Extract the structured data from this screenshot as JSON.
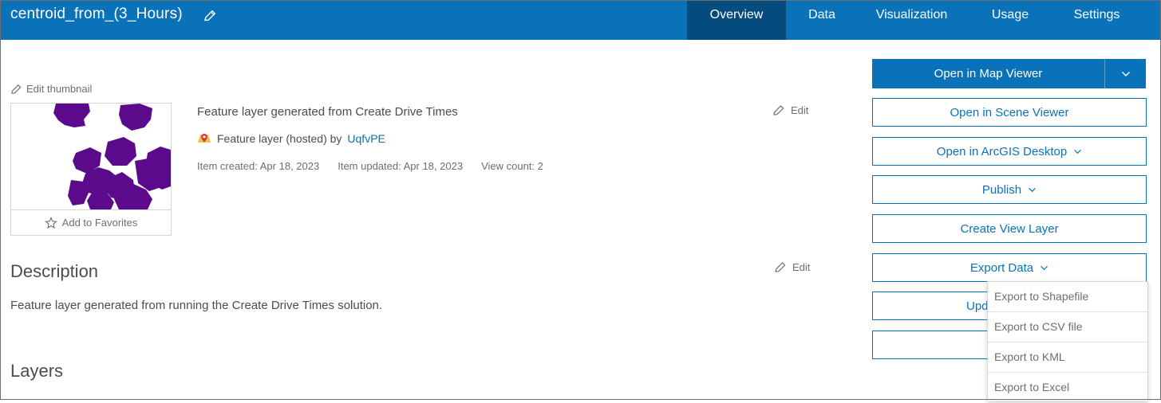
{
  "header": {
    "title": "centroid_from_(3_Hours)",
    "tabs": [
      {
        "label": "Overview",
        "active": true
      },
      {
        "label": "Data",
        "active": false
      },
      {
        "label": "Visualization",
        "active": false
      },
      {
        "label": "Usage",
        "active": false
      },
      {
        "label": "Settings",
        "active": false
      }
    ]
  },
  "thumbnail": {
    "edit_label": "Edit thumbnail",
    "favorites_label": "Add to Favorites"
  },
  "summary": {
    "text": "Feature layer generated from Create Drive Times",
    "edit_label": "Edit",
    "type_text": "Feature layer (hosted) by",
    "owner": "UqfvPE",
    "created": "Item created: Apr 18, 2023",
    "updated": "Item updated: Apr 18, 2023",
    "views": "View count: 2"
  },
  "description": {
    "heading": "Description",
    "edit_label": "Edit",
    "text": "Feature layer generated from running the Create Drive Times solution."
  },
  "layers": {
    "heading": "Layers"
  },
  "actions": {
    "open_map_viewer": "Open in Map Viewer",
    "open_scene_viewer": "Open in Scene Viewer",
    "open_arcgis_desktop": "Open in ArcGIS Desktop",
    "publish": "Publish",
    "create_view_layer": "Create View Layer",
    "export_data": "Export Data",
    "update_partial": "Upd"
  },
  "export_menu": [
    "Export to Shapefile",
    "Export to CSV file",
    "Export to KML",
    "Export to Excel"
  ],
  "colors": {
    "brand": "#0a72b9",
    "tab_active": "#064b7d",
    "polygon_fill": "#5c0a8c"
  }
}
